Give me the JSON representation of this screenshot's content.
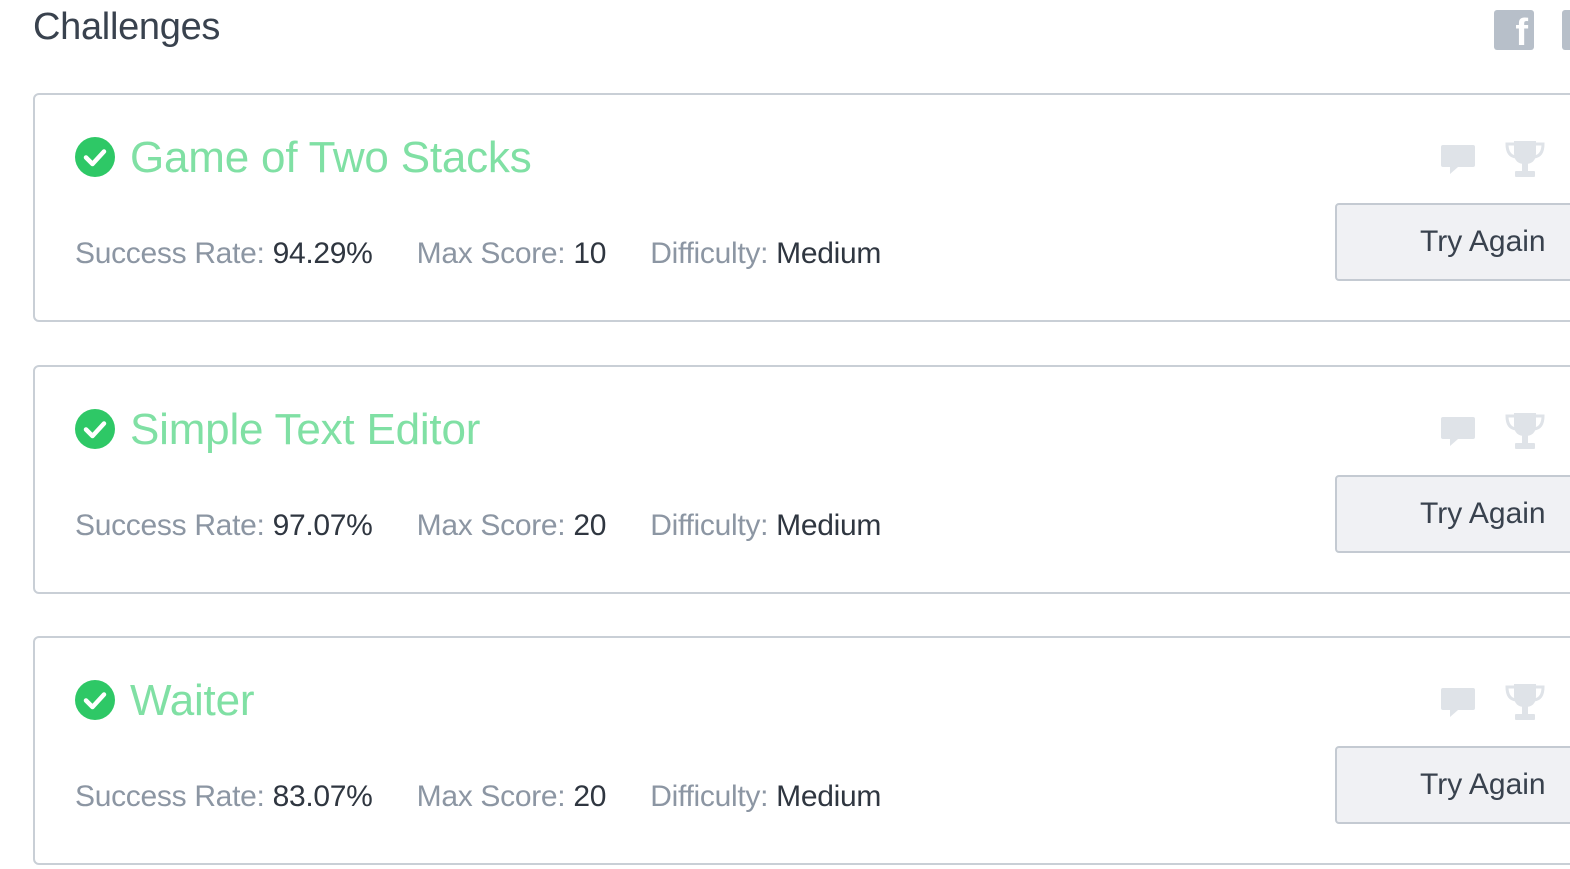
{
  "header": {
    "title": "Challenges",
    "share_icon": "facebook-icon"
  },
  "colors": {
    "solved_green": "#2ec866",
    "title_green": "#80e0a4",
    "label_gray": "#8c96a3",
    "value_dark": "#2f3640",
    "icon_gray": "#dfe3e8"
  },
  "labels": {
    "success_rate": "Success Rate:",
    "max_score": "Max Score:",
    "difficulty": "Difficulty:"
  },
  "challenges": [
    {
      "title": "Game of Two Stacks",
      "status_icon": "check-circle-icon",
      "success_rate": "94.29%",
      "max_score": "10",
      "difficulty": "Medium",
      "action_label": "Try Again"
    },
    {
      "title": "Simple Text Editor",
      "status_icon": "check-circle-icon",
      "success_rate": "97.07%",
      "max_score": "20",
      "difficulty": "Medium",
      "action_label": "Try Again"
    },
    {
      "title": "Waiter",
      "status_icon": "check-circle-icon",
      "success_rate": "83.07%",
      "max_score": "20",
      "difficulty": "Medium",
      "action_label": "Try Again"
    }
  ]
}
